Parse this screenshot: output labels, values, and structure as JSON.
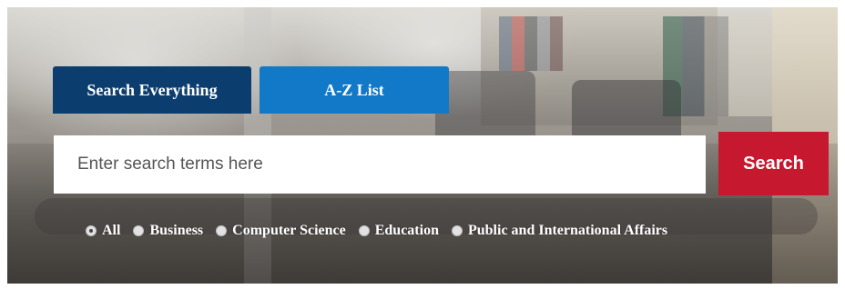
{
  "tabs": [
    {
      "label": "Search Everything",
      "active": true
    },
    {
      "label": "A-Z List",
      "active": false
    }
  ],
  "search": {
    "placeholder": "Enter search terms here",
    "value": "",
    "button_label": "Search"
  },
  "filters": [
    {
      "label": "All",
      "checked": true
    },
    {
      "label": "Business",
      "checked": false
    },
    {
      "label": "Computer Science",
      "checked": false
    },
    {
      "label": "Education",
      "checked": false
    },
    {
      "label": "Public and International Affairs",
      "checked": false
    }
  ],
  "colors": {
    "tab_active": "#0b3e6e",
    "tab_inactive": "#1278c8",
    "search_button": "#c6182f"
  }
}
